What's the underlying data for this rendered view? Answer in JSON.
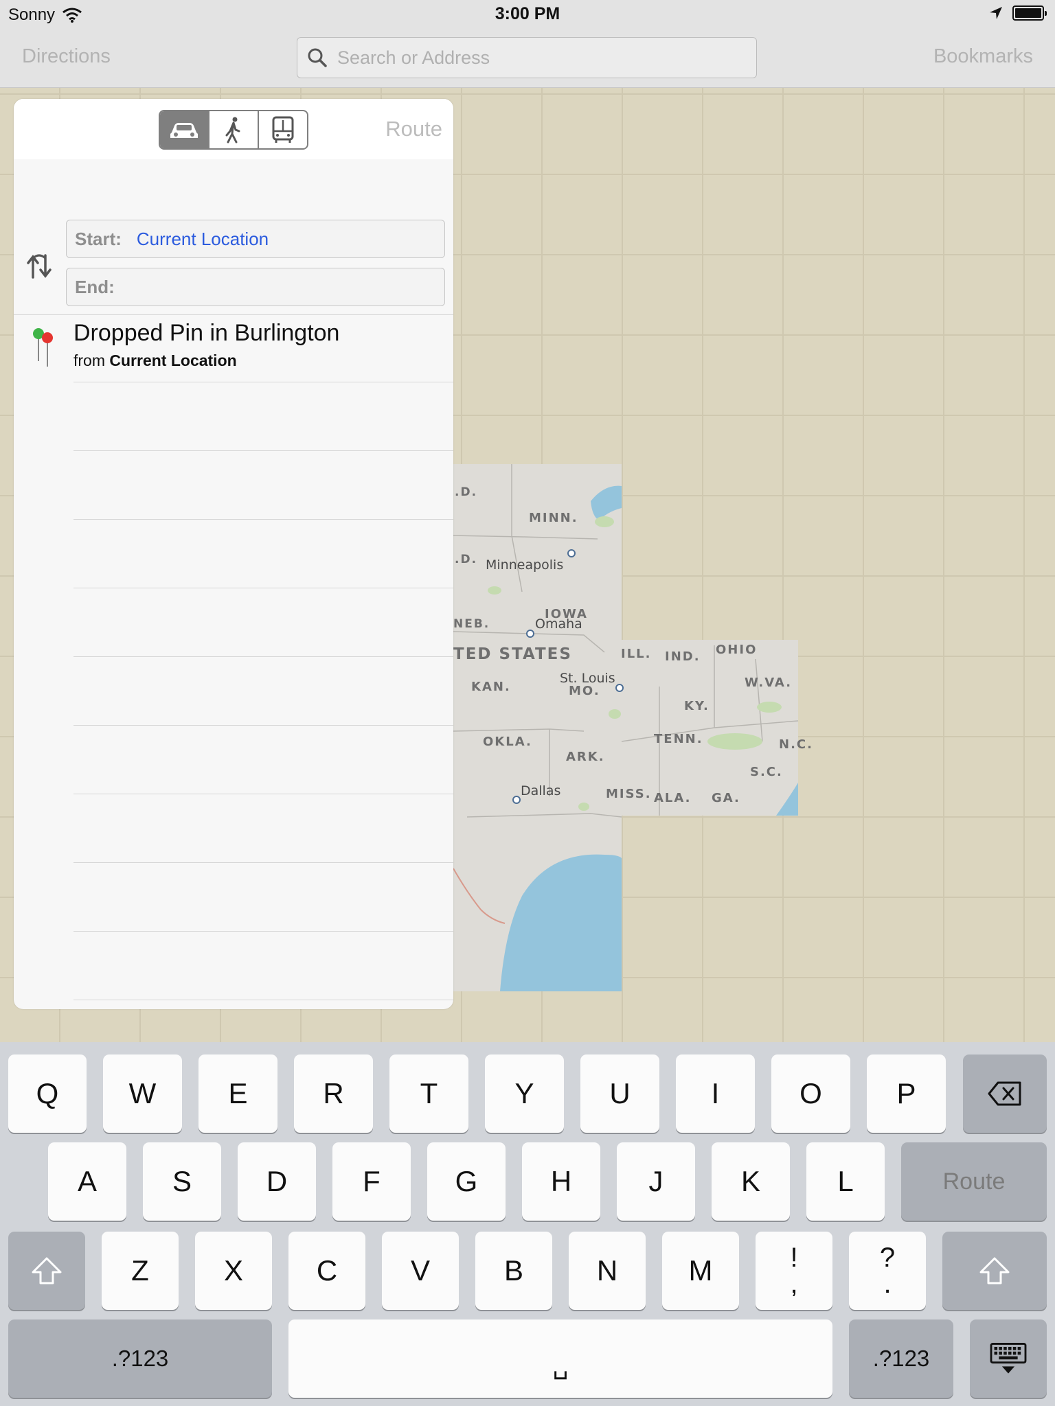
{
  "status_bar": {
    "carrier": "Sonny",
    "time": "3:00 PM"
  },
  "nav": {
    "directions_label": "Directions",
    "search_placeholder": "Search or Address",
    "bookmarks_label": "Bookmarks"
  },
  "directions_panel": {
    "transport_modes": [
      "car-icon",
      "walk-icon",
      "bus-icon"
    ],
    "selected_mode": "car",
    "route_label": "Route",
    "start_label": "Start:",
    "start_value": "Current Location",
    "end_label": "End:",
    "end_value": "",
    "recent": [
      {
        "title": "Dropped Pin in Burlington",
        "sub_prefix": "from",
        "sub_bold": "Current Location"
      }
    ]
  },
  "map": {
    "region_labels": [
      ".D.",
      "MINN.",
      ".D.",
      "IOWA",
      "NEB.",
      "TED STATES",
      "KAN.",
      "MO.",
      "ILL.",
      "IND.",
      "OHIO",
      "W.VA.",
      "KY.",
      "OKLA.",
      "ARK.",
      "TENN.",
      "N.C.",
      "S.C.",
      "MISS.",
      "ALA.",
      "GA."
    ],
    "city_labels": [
      "Minneapolis",
      "Omaha",
      "St. Louis",
      "Dallas"
    ]
  },
  "keyboard": {
    "row1": [
      "Q",
      "W",
      "E",
      "R",
      "T",
      "Y",
      "U",
      "I",
      "O",
      "P"
    ],
    "row2": [
      "A",
      "S",
      "D",
      "F",
      "G",
      "H",
      "J",
      "K",
      "L"
    ],
    "row3": [
      "Z",
      "X",
      "C",
      "V",
      "B",
      "N",
      "M"
    ],
    "punct1": {
      "top": "!",
      "bottom": ","
    },
    "punct2": {
      "top": "?",
      "bottom": "."
    },
    "route_key": "Route",
    "num_key": ".?123",
    "space_glyph": "␣"
  },
  "colors": {
    "accent": "#2b5bde",
    "map_bg": "#dcd6bf",
    "water": "#94c4dc"
  }
}
